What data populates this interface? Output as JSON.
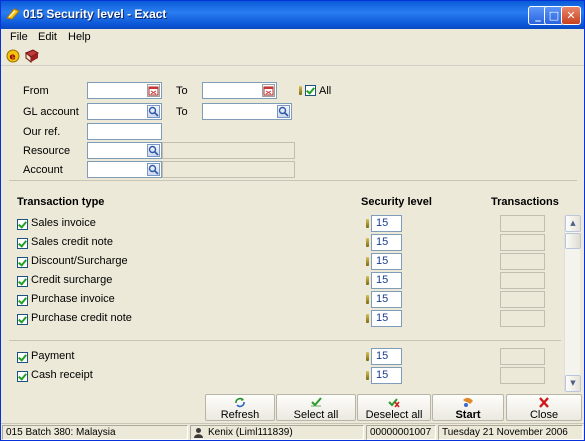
{
  "window": {
    "title": "015 Security level - Exact"
  },
  "menu": [
    "File",
    "Edit",
    "Help"
  ],
  "toolbar": {
    "icons": [
      "exact-logo-icon",
      "book-icon"
    ]
  },
  "filter": {
    "from_label": "From",
    "to_label": "To",
    "all_label": "All",
    "all_checked": true,
    "gl_label": "GL account",
    "gl_to_label": "To",
    "ourref_label": "Our ref.",
    "resource_label": "Resource",
    "account_label": "Account"
  },
  "table": {
    "col_type": "Transaction type",
    "col_security": "Security level",
    "col_transactions": "Transactions",
    "rows": [
      {
        "label": "Sales invoice",
        "checked": true,
        "level": "15"
      },
      {
        "label": "Sales credit note",
        "checked": true,
        "level": "15"
      },
      {
        "label": "Discount/Surcharge",
        "checked": true,
        "level": "15"
      },
      {
        "label": "Credit surcharge",
        "checked": true,
        "level": "15"
      },
      {
        "label": "Purchase invoice",
        "checked": true,
        "level": "15"
      },
      {
        "label": "Purchase credit note",
        "checked": true,
        "level": "15"
      }
    ],
    "rows2": [
      {
        "label": "Payment",
        "checked": true,
        "level": "15"
      },
      {
        "label": "Cash receipt",
        "checked": true,
        "level": "15"
      }
    ]
  },
  "buttons": {
    "refresh": "Refresh",
    "select_all": "Select all",
    "deselect_all": "Deselect all",
    "start": "Start",
    "close": "Close"
  },
  "status": {
    "batch": "015 Batch 380: Malaysia",
    "user": "Kenix (Liml111839)",
    "number": "00000001007",
    "date": "Tuesday 21 November 2006"
  },
  "colors": {
    "title_bar": "#0a5bd8",
    "accent_blue": "#1a3c9a",
    "check_green": "#21a121"
  }
}
